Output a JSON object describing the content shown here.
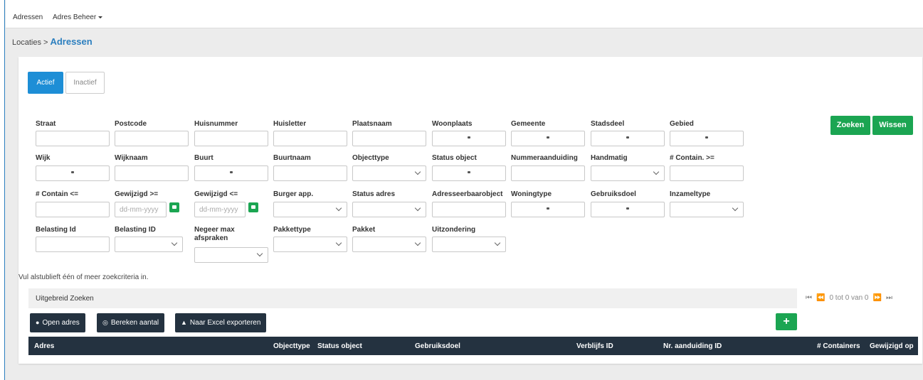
{
  "nav": {
    "items": [
      "Adressen",
      "Adres Beheer"
    ]
  },
  "breadcrumb": {
    "parent": "Locaties >",
    "current": "Adressen"
  },
  "tabs": [
    "Actief",
    "Inactief"
  ],
  "fields": {
    "straat": "Straat",
    "postcode": "Postcode",
    "huisnummer": "Huisnummer",
    "huisletter": "Huisletter",
    "plaatsnaam": "Plaatsnaam",
    "woonplaats": "Woonplaats",
    "gemeente": "Gemeente",
    "stadsdeel": "Stadsdeel",
    "gebied": "Gebied",
    "wijk": "Wijk",
    "wijknaam": "Wijknaam",
    "buurt": "Buurt",
    "buurtnaam": "Buurtnaam",
    "objecttype": "Objecttype",
    "status_object": "Status object",
    "nummeraanduiding": "Nummeraanduiding",
    "handmatig": "Handmatig",
    "contain_gte": "# Contain. >=",
    "contain_lte": "# Contain <=",
    "gewijzigd_gte": "Gewijzigd >=",
    "gewijzigd_lte": "Gewijzigd <=",
    "burger_app": "Burger app.",
    "status_adres": "Status adres",
    "adresseerbaarobject": "Adresseerbaarobject",
    "woningtype": "Woningtype",
    "gebruiksdoel": "Gebruiksdoel",
    "inzameltype": "Inzameltype",
    "belasting_id_1": "Belasting Id",
    "belasting_id_2": "Belasting ID",
    "negeer_max_1": "Negeer max",
    "negeer_max_2": "afspraken",
    "pakkettype": "Pakkettype",
    "pakket": "Pakket",
    "uitzondering": "Uitzondering"
  },
  "date_placeholder": "dd-mm-yyyy",
  "buttons": {
    "zoeken": "Zoeken",
    "wissen": "Wissen"
  },
  "note": "Vul alstublieft één of meer zoekcriteria in.",
  "extended_search": "Uitgebreid Zoeken",
  "pager": {
    "text": "0 tot 0 van 0"
  },
  "actions": {
    "open": "Open adres",
    "count": "Bereken aantal",
    "export": "Naar Excel exporteren",
    "add": "+"
  },
  "columns": [
    "Adres",
    "Objecttype",
    "Status object",
    "Gebruiksdoel",
    "Verblijfs ID",
    "Nr. aanduiding ID",
    "# Containers",
    "Gewijzigd op"
  ],
  "colors": {
    "primary": "#1d8ed6",
    "green": "#1ba552",
    "dark": "#243240"
  }
}
